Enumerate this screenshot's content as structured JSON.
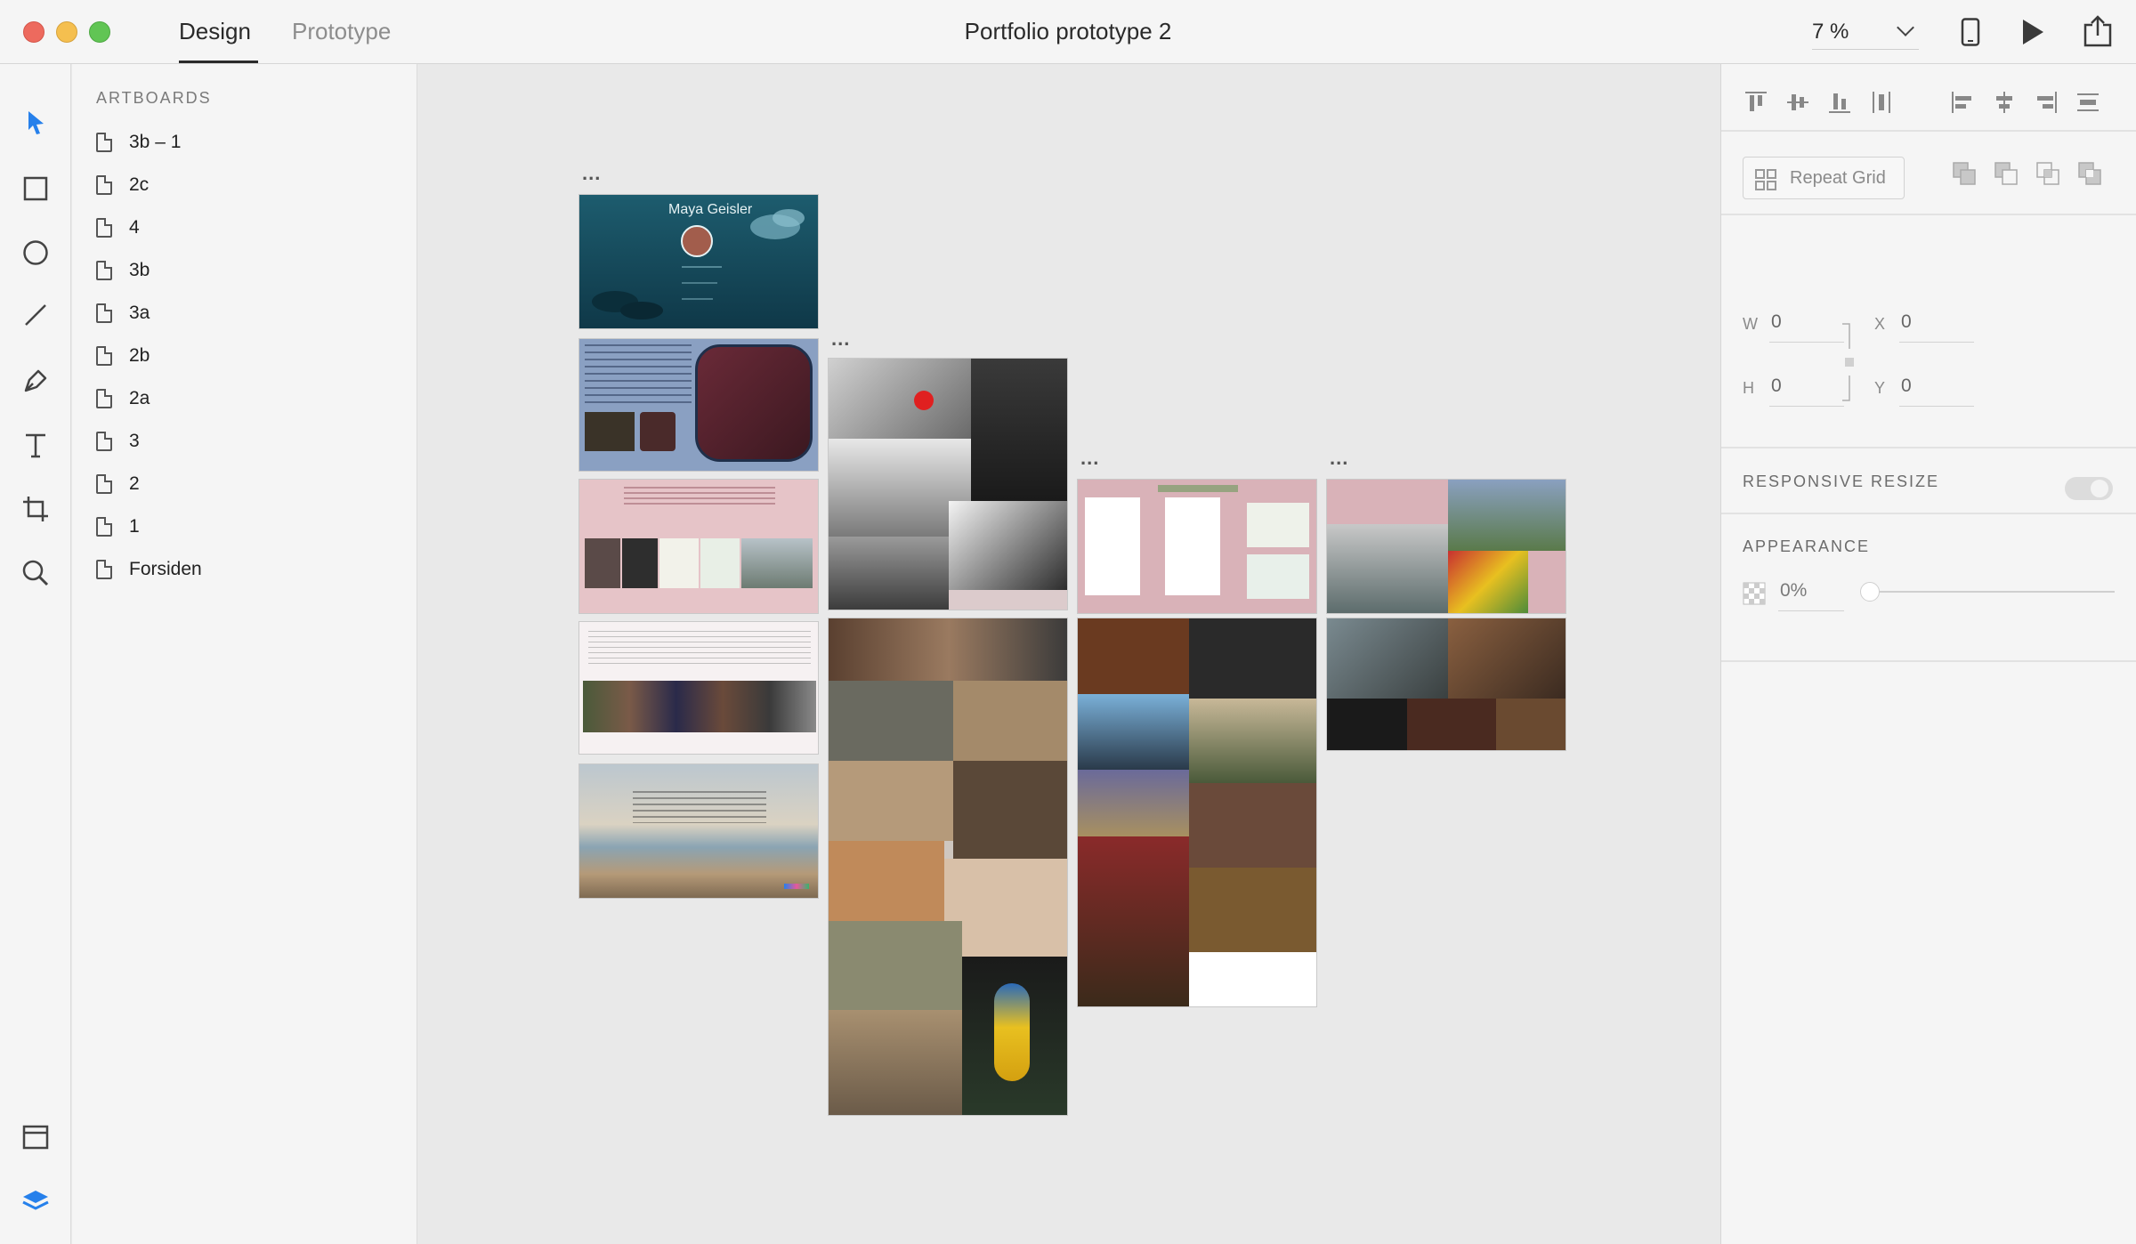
{
  "window": {
    "title": "Portfolio prototype 2",
    "tabs": [
      {
        "label": "Design",
        "active": true
      },
      {
        "label": "Prototype",
        "active": false
      }
    ],
    "zoom": "7 %"
  },
  "toolbar": {
    "tools": [
      "select-tool-icon",
      "rectangle-tool-icon",
      "ellipse-tool-icon",
      "line-tool-icon",
      "pen-tool-icon",
      "text-tool-icon",
      "artboard-tool-icon",
      "zoom-tool-icon"
    ],
    "bottom": [
      "assets-panel-icon",
      "layers-panel-icon"
    ]
  },
  "layers": {
    "heading": "ARTBOARDS",
    "items": [
      "3b – 1",
      "2c",
      "4",
      "3b",
      "3a",
      "2b",
      "2a",
      "3",
      "2",
      "1",
      "Forsiden"
    ]
  },
  "canvas": {
    "artboards": {
      "forsiden_name": "Maya Geisler",
      "more_label": "..."
    }
  },
  "inspector": {
    "repeat_grid": "Repeat Grid",
    "fields": {
      "w_label": "W",
      "w": "0",
      "x_label": "X",
      "x": "0",
      "h_label": "H",
      "h": "0",
      "y_label": "Y",
      "y": "0"
    },
    "responsive_resize": "RESPONSIVE RESIZE",
    "responsive_resize_on": false,
    "appearance": "APPEARANCE",
    "opacity": "0%"
  },
  "colors": {
    "accent": "#2680eb",
    "close": "#ed6a5e",
    "minimize": "#f5bf4f",
    "maximize": "#61c554"
  }
}
